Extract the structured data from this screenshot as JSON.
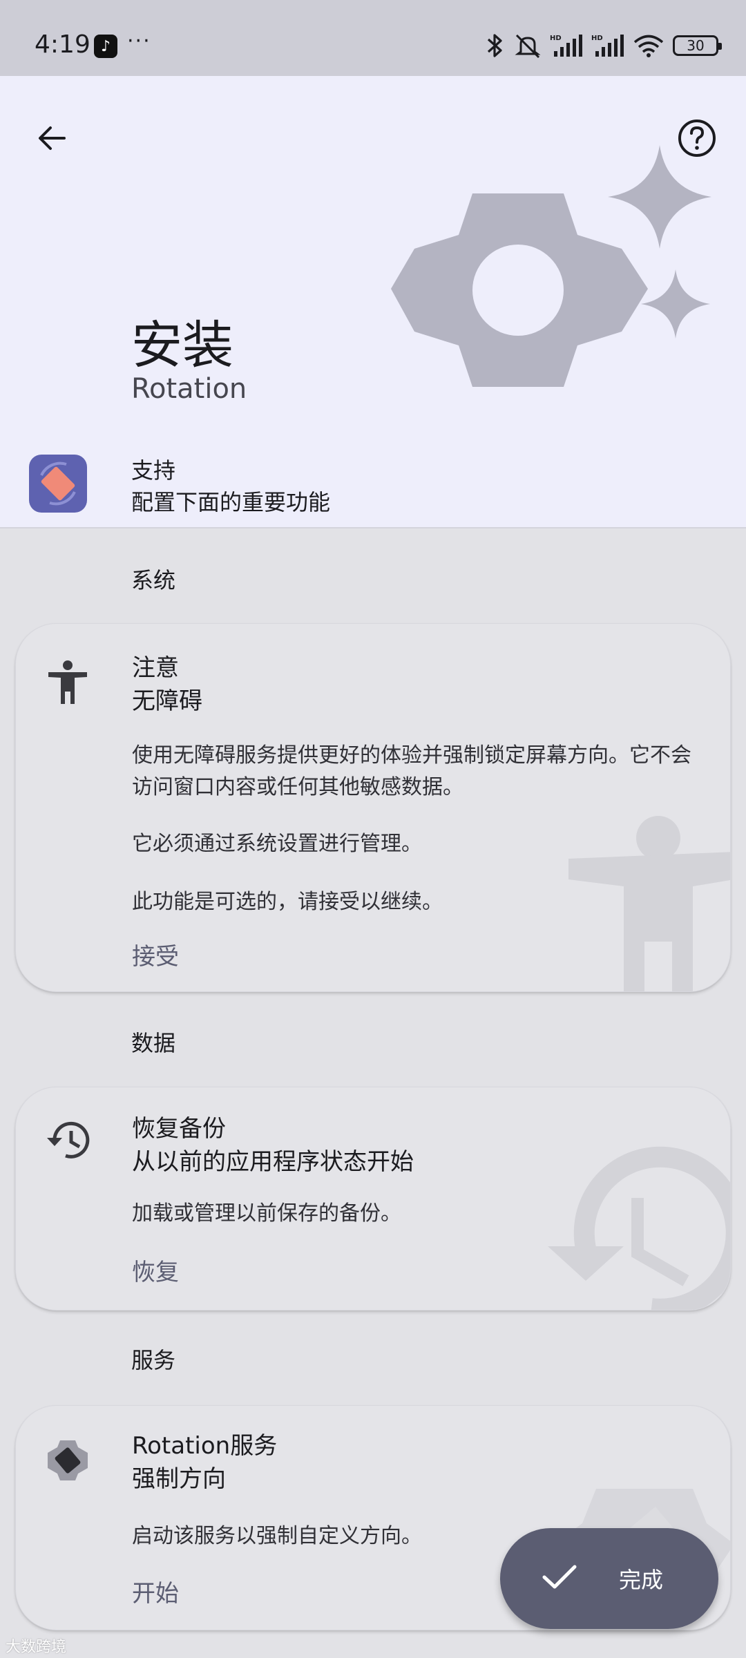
{
  "status_bar": {
    "time": "4:19",
    "more": "···",
    "battery": "30",
    "icons": [
      "tiktok-icon",
      "bluetooth-icon",
      "mute-icon",
      "signal-hd-icon",
      "signal-hd-icon",
      "wifi-icon",
      "battery-icon"
    ]
  },
  "header": {
    "title": "安装",
    "subtitle": "Rotation",
    "support_title": "支持",
    "support_subtitle": "配置下面的重要功能",
    "back_icon": "arrow-back-icon",
    "help_icon": "help-circle-icon"
  },
  "sections": {
    "system": "系统",
    "data": "数据",
    "service": "服务"
  },
  "cards": {
    "accessibility": {
      "title": "注意",
      "subtitle": "无障碍",
      "body1": "使用无障碍服务提供更好的体验并强制锁定屏幕方向。它不会访问窗口内容或任何其他敏感数据。",
      "body2": "它必须通过系统设置进行管理。",
      "body3": "此功能是可选的，请接受以继续。",
      "action": "接受"
    },
    "backup": {
      "title": "恢复备份",
      "subtitle": "从以前的应用程序状态开始",
      "body": "加载或管理以前保存的备份。",
      "action": "恢复"
    },
    "service": {
      "title": "Rotation服务",
      "subtitle": "强制方向",
      "body": "启动该服务以强制自定义方向。",
      "action": "开始"
    }
  },
  "fab": {
    "label": "完成"
  },
  "watermark": "大数跨境",
  "colors": {
    "header_bg": "#eeeefb",
    "page_bg": "#e2e2e6",
    "accent": "#5b5d72",
    "app_icon_bg": "#5e62b0",
    "app_icon_fg": "#f08a78"
  }
}
